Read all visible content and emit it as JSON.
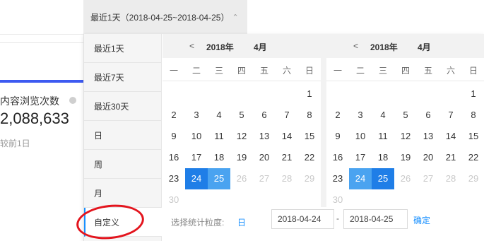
{
  "header": {
    "range_label": "最近1天（2018-04-25~2018-04-25）",
    "caret": "⌃"
  },
  "metric": {
    "label": "内容浏览次数",
    "value": "2,088,633",
    "compare": "较前1日"
  },
  "presets": [
    {
      "label": "最近1天",
      "active": false
    },
    {
      "label": "最近7天",
      "active": false
    },
    {
      "label": "最近30天",
      "active": false
    },
    {
      "label": "日",
      "active": false
    },
    {
      "label": "周",
      "active": false
    },
    {
      "label": "月",
      "active": false
    },
    {
      "label": "自定义",
      "active": true
    }
  ],
  "weekdays": [
    "一",
    "二",
    "三",
    "四",
    "五",
    "六",
    "日"
  ],
  "calendars": [
    {
      "prev": "<",
      "year": "2018年",
      "month": "4月",
      "weeks": [
        [
          "",
          "",
          "",
          "",
          "",
          "",
          "1"
        ],
        [
          "2",
          "3",
          "4",
          "5",
          "6",
          "7",
          "8"
        ],
        [
          "9",
          "10",
          "11",
          "12",
          "13",
          "14",
          "15"
        ],
        [
          "16",
          "17",
          "18",
          "19",
          "20",
          "21",
          "22"
        ],
        [
          "23",
          "24",
          "25",
          "26",
          "27",
          "28",
          "29"
        ],
        [
          "30",
          "",
          "",
          "",
          "",
          "",
          ""
        ]
      ],
      "selected": "24",
      "in_range": [
        "25"
      ],
      "disabled": [
        "26",
        "27",
        "28",
        "29",
        "30"
      ]
    },
    {
      "prev": "<",
      "year": "2018年",
      "month": "4月",
      "weeks": [
        [
          "",
          "",
          "",
          "",
          "",
          "",
          "1"
        ],
        [
          "2",
          "3",
          "4",
          "5",
          "6",
          "7",
          "8"
        ],
        [
          "9",
          "10",
          "11",
          "12",
          "13",
          "14",
          "15"
        ],
        [
          "16",
          "17",
          "18",
          "19",
          "20",
          "21",
          "22"
        ],
        [
          "23",
          "24",
          "25",
          "26",
          "27",
          "28",
          "29"
        ],
        [
          "30",
          "",
          "",
          "",
          "",
          "",
          ""
        ]
      ],
      "selected": "25",
      "in_range": [
        "24"
      ],
      "disabled": [
        "26",
        "27",
        "28",
        "29",
        "30"
      ]
    }
  ],
  "footer": {
    "granularity_label": "选择统计粒度:",
    "granularity_value": "日",
    "start_date": "2018-04-24",
    "separator": "-",
    "end_date": "2018-04-25",
    "confirm_label": "确定"
  },
  "colors": {
    "selected": "#1f7ee7",
    "range": "#4aa3f0",
    "accent": "#1890ff",
    "annotation": "#e3141d"
  }
}
